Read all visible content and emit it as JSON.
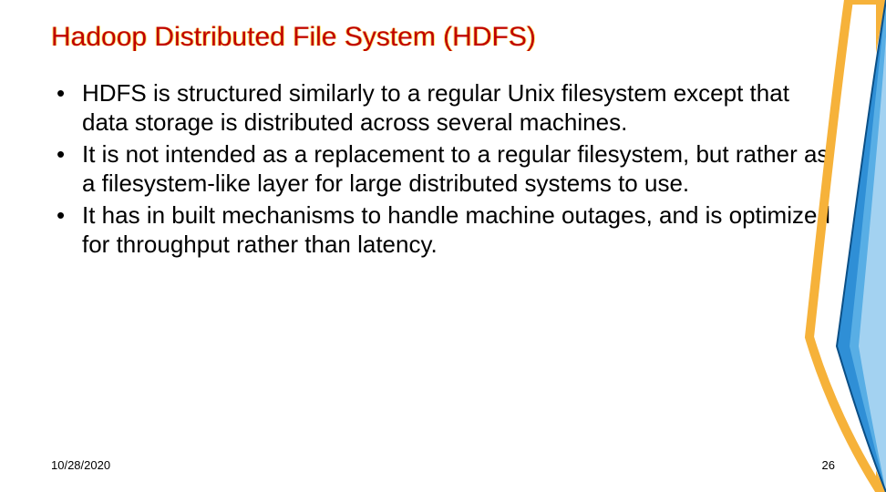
{
  "title": "Hadoop Distributed File System (HDFS)",
  "bullets": [
    "HDFS is structured similarly to a regular Unix filesystem except that data storage is distributed across several machines.",
    "It is not intended as a replacement to a regular filesystem, but rather as a filesystem-like layer for large distributed systems to use.",
    "It has in built mechanisms to handle machine outages, and is optimized for throughput rather than latency."
  ],
  "footer": {
    "date": "10/28/2020",
    "page": "26"
  },
  "theme": {
    "title_color": "#c00000",
    "swoosh_blue": "#2f8fd6",
    "swoosh_gold": "#f6b23a"
  }
}
